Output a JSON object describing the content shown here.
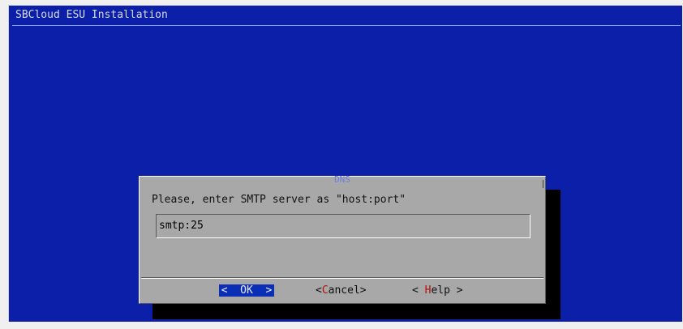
{
  "app": {
    "backtitle": "SBCloud ESU Installation"
  },
  "dialog": {
    "title": "DNS",
    "prompt": "Please, enter SMTP server as \"host:port\"",
    "input_value": "smtp:25",
    "buttons": {
      "ok": {
        "left": "<",
        "label": "OK",
        "right": ">"
      },
      "cancel": {
        "left": "<",
        "hotkey": "C",
        "rest": "ancel",
        "right": ">"
      },
      "help": {
        "left": "< ",
        "hotkey": "H",
        "rest": "elp",
        "right": " >"
      }
    }
  },
  "colors": {
    "background": "#0b1fa8",
    "dialog": "#a8a8a8",
    "selected_button": "#0a2eb6",
    "hotkey": "#b01010"
  }
}
